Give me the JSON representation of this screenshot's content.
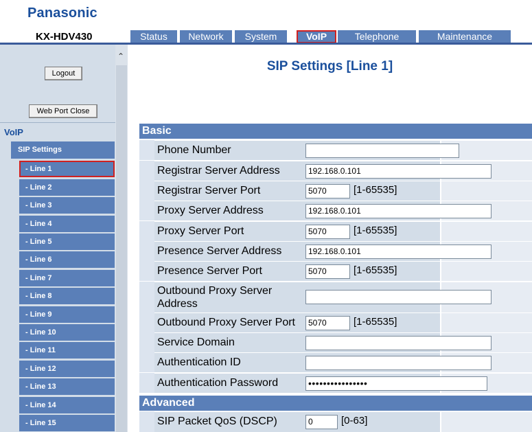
{
  "header": {
    "brand": "Panasonic",
    "model": "KX-HDV430",
    "tabs": [
      {
        "label": "Status"
      },
      {
        "label": "Network"
      },
      {
        "label": "System"
      },
      {
        "label": "VoIP"
      },
      {
        "label": "Telephone"
      },
      {
        "label": "Maintenance"
      }
    ],
    "active_tab": "VoIP"
  },
  "sidebar": {
    "logout_label": "Logout",
    "web_port_close_label": "Web Port Close",
    "section_label": "VoIP",
    "sip_settings_label": "SIP Settings",
    "lines": [
      "- Line 1",
      "- Line 2",
      "- Line 3",
      "- Line 4",
      "- Line 5",
      "- Line 6",
      "- Line 7",
      "- Line 8",
      "- Line 9",
      "- Line 10",
      "- Line 11",
      "- Line 12",
      "- Line 13",
      "- Line 14",
      "- Line 15"
    ],
    "selected_line": "- Line 1"
  },
  "main": {
    "title": "SIP Settings [Line 1]",
    "basic_header": "Basic",
    "advanced_header": "Advanced",
    "fields": {
      "phone_number": {
        "label": "Phone Number",
        "value": ""
      },
      "registrar_address": {
        "label": "Registrar Server Address",
        "value": "192.168.0.101"
      },
      "registrar_port": {
        "label": "Registrar Server Port",
        "value": "5070",
        "range": "[1-65535]"
      },
      "proxy_address": {
        "label": "Proxy Server Address",
        "value": "192.168.0.101"
      },
      "proxy_port": {
        "label": "Proxy Server Port",
        "value": "5070",
        "range": "[1-65535]"
      },
      "presence_address": {
        "label": "Presence Server Address",
        "value": "192.168.0.101"
      },
      "presence_port": {
        "label": "Presence Server Port",
        "value": "5070",
        "range": "[1-65535]"
      },
      "outbound_address": {
        "label_line1": "Outbound Proxy Server",
        "label_line2": "Address",
        "value": ""
      },
      "outbound_port": {
        "label": "Outbound Proxy Server Port",
        "value": "5070",
        "range": "[1-65535]"
      },
      "service_domain": {
        "label": "Service Domain",
        "value": ""
      },
      "auth_id": {
        "label": "Authentication ID",
        "value": ""
      },
      "auth_password": {
        "label": "Authentication Password",
        "value": "••••••••••••••••"
      },
      "sip_qos": {
        "label": "SIP Packet QoS (DSCP)",
        "value": "0",
        "range": "[0-63]"
      }
    }
  },
  "colors": {
    "brand": "#1a4f9c",
    "tab": "#5a7fb8",
    "highlight": "#d02020",
    "row_label": "#d3dde8"
  }
}
